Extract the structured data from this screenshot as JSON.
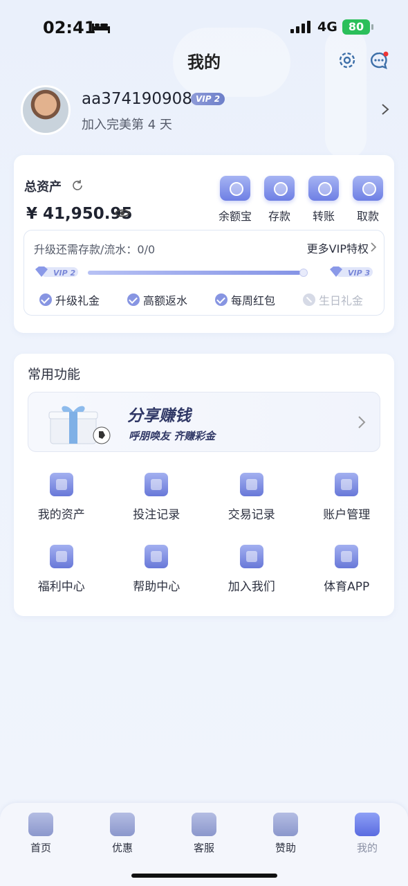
{
  "status_bar": {
    "time": "02:41",
    "network": "4G",
    "battery": "80"
  },
  "header": {
    "title": "我的"
  },
  "profile": {
    "username": "aa374190908",
    "vip_badge": "VIP 2",
    "joined_text": "加入完美第 4 天"
  },
  "assets": {
    "label": "总资产",
    "value": "¥ 41,950.95",
    "actions": [
      {
        "label": "余额宝",
        "icon": "savings-icon"
      },
      {
        "label": "存款",
        "icon": "wallet-icon"
      },
      {
        "label": "转账",
        "icon": "transfer-icon"
      },
      {
        "label": "取款",
        "icon": "withdraw-icon"
      }
    ]
  },
  "vip_progress": {
    "upgrade_text": "升级还需存款/流水：0/0",
    "more_link": "更多VIP特权",
    "current_level": "VIP 2",
    "next_level": "VIP 3",
    "progress": 0.97,
    "perks": [
      {
        "label": "升级礼金",
        "enabled": true
      },
      {
        "label": "高额返水",
        "enabled": true
      },
      {
        "label": "每周红包",
        "enabled": true
      },
      {
        "label": "生日礼金",
        "enabled": false
      }
    ]
  },
  "functions": {
    "title": "常用功能",
    "share": {
      "heading": "分享赚钱",
      "subheading": "呼朋唤友 齐赚彩金"
    },
    "items": [
      {
        "label": "我的资产",
        "icon": "wallet-icon"
      },
      {
        "label": "投注记录",
        "icon": "bet-record-icon"
      },
      {
        "label": "交易记录",
        "icon": "transaction-icon"
      },
      {
        "label": "账户管理",
        "icon": "account-icon"
      },
      {
        "label": "福利中心",
        "icon": "gift-icon"
      },
      {
        "label": "帮助中心",
        "icon": "help-book-icon"
      },
      {
        "label": "加入我们",
        "icon": "people-icon"
      },
      {
        "label": "体育APP",
        "icon": "phone-icon"
      }
    ]
  },
  "tabbar": {
    "tabs": [
      {
        "label": "首页",
        "icon": "home-icon"
      },
      {
        "label": "优惠",
        "icon": "promo-icon"
      },
      {
        "label": "客服",
        "icon": "headset-icon"
      },
      {
        "label": "赞助",
        "icon": "crown-icon"
      },
      {
        "label": "我的",
        "icon": "user-icon",
        "active": true
      }
    ]
  },
  "colors": {
    "accent": "#6e7fe4",
    "background": "#edf2fb",
    "battery": "#2bbf5a",
    "notification": "#e33"
  }
}
